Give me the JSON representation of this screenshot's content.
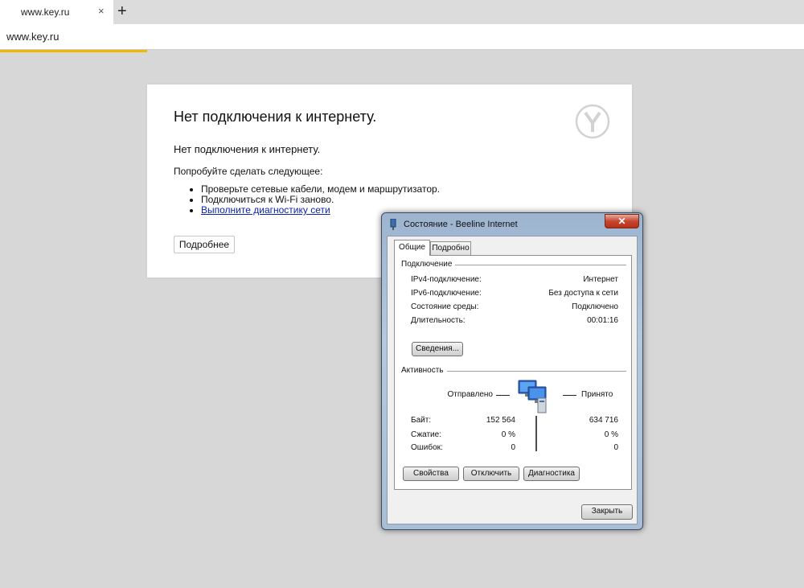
{
  "browser": {
    "tab_title": "www.key.ru",
    "tab_close": "×",
    "new_tab": "+",
    "address": "www.key.ru",
    "progress_fraction": 0.183,
    "accent": "#f2b705"
  },
  "error_page": {
    "title": "Нет подключения к интернету.",
    "message": "Нет подключения к интернету.",
    "try_label": "Попробуйте сделать следующее:",
    "suggestions": [
      "Проверьте сетевые кабели, модем и маршрутизатор.",
      "Подключиться к Wi-Fi заново."
    ],
    "diagnostics_link": "Выполните диагностику сети",
    "more_button": "Подробнее",
    "logo_icon": "yandex-browser-logo"
  },
  "dialog": {
    "title": "Состояние - Beeline Internet",
    "close_glyph": "✕",
    "tabs": [
      "Общие",
      "Подробно"
    ],
    "connection": {
      "label": "Подключение",
      "rows": [
        {
          "label": "IPv4-подключение:",
          "value": "Интернет"
        },
        {
          "label": "IPv6-подключение:",
          "value": "Без доступа к сети"
        },
        {
          "label": "Состояние среды:",
          "value": "Подключено"
        },
        {
          "label": "Длительность:",
          "value": "00:01:16"
        }
      ],
      "details_button": "Сведения..."
    },
    "activity": {
      "label": "Активность",
      "sent_label": "Отправлено",
      "received_label": "Принято",
      "rows": [
        {
          "label": "Байт:",
          "sent": "152 564",
          "received": "634 716"
        },
        {
          "label": "Сжатие:",
          "sent": "0 %",
          "received": "0 %"
        },
        {
          "label": "Ошибок:",
          "sent": "0",
          "received": "0"
        }
      ],
      "network_icon": "network-computers-icon"
    },
    "buttons": {
      "properties": "Свойства",
      "disable": "Отключить",
      "diagnose": "Диагностика",
      "close": "Закрыть"
    }
  }
}
